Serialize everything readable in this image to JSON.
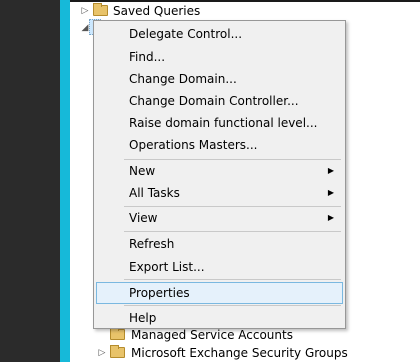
{
  "tree": {
    "saved_queries": "Saved Queries",
    "managed_service_accounts": "Managed Service Accounts",
    "exchange_security_groups": "Microsoft Exchange Security Groups"
  },
  "context_menu": {
    "delegate_control": "Delegate Control...",
    "find": "Find...",
    "change_domain": "Change Domain...",
    "change_domain_controller": "Change Domain Controller...",
    "raise_functional_level": "Raise domain functional level...",
    "operations_masters": "Operations Masters...",
    "new": "New",
    "all_tasks": "All Tasks",
    "view": "View",
    "refresh": "Refresh",
    "export_list": "Export List...",
    "properties": "Properties",
    "help": "Help"
  },
  "colors": {
    "accent_cyan": "#16b9d9",
    "menu_bg": "#f0f0f0",
    "highlight": "#e5f1fb"
  }
}
